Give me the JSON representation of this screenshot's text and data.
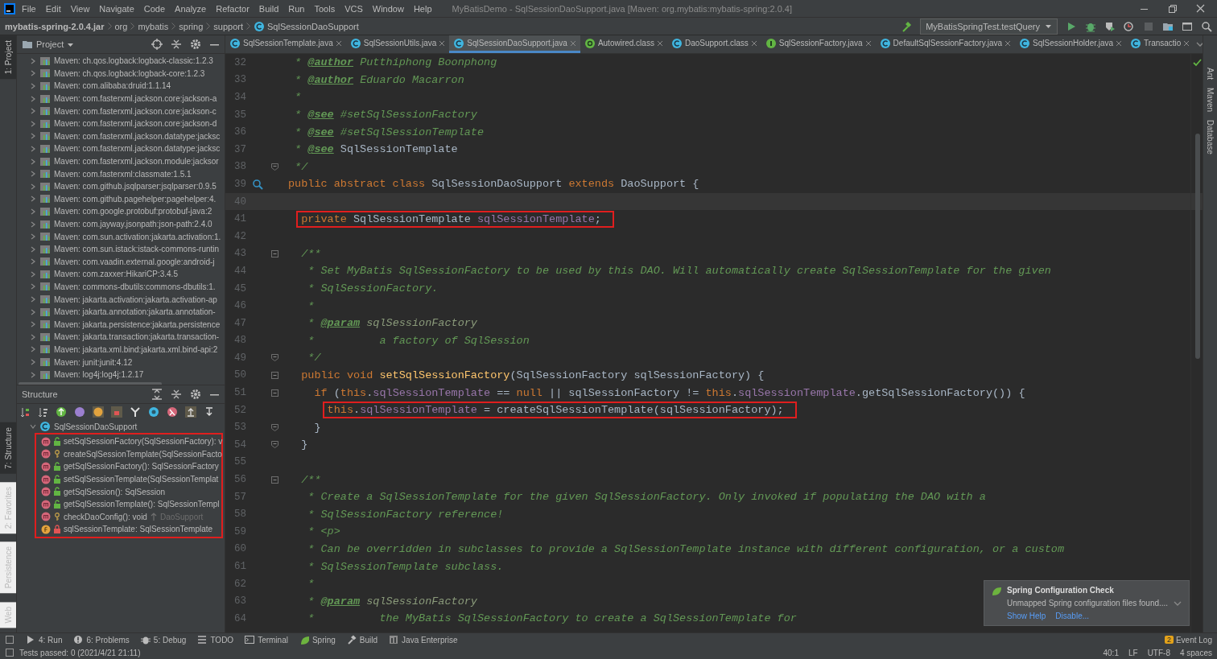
{
  "window": {
    "title": "MyBatisDemo - SqlSessionDaoSupport.java [Maven: org.mybatis:mybatis-spring:2.0.4]",
    "menu": [
      "File",
      "Edit",
      "View",
      "Navigate",
      "Code",
      "Analyze",
      "Refactor",
      "Build",
      "Run",
      "Tools",
      "VCS",
      "Window",
      "Help"
    ]
  },
  "breadcrumbs": [
    {
      "label": "mybatis-spring-2.0.4.jar",
      "kind": "jar"
    },
    {
      "label": "org",
      "kind": "package"
    },
    {
      "label": "mybatis",
      "kind": "package"
    },
    {
      "label": "spring",
      "kind": "package"
    },
    {
      "label": "support",
      "kind": "package"
    },
    {
      "label": "SqlSessionDaoSupport",
      "kind": "class"
    }
  ],
  "run_config": {
    "label": "MyBatisSpringTest.testQuery"
  },
  "left_strip": [
    {
      "label": "1: Project",
      "selected": true
    },
    {
      "label": "7: Structure",
      "selected": true
    },
    {
      "label": "2: Favorites",
      "selected": false
    },
    {
      "label": "Persistence",
      "selected": false
    },
    {
      "label": "Web",
      "selected": false
    }
  ],
  "right_strip": [
    {
      "label": "Ant"
    },
    {
      "label": "Maven"
    },
    {
      "label": "Database"
    }
  ],
  "project": {
    "title": "Project",
    "items": [
      {
        "label": "Maven: ch.qos.logback:logback-classic:1.2.3",
        "expanded": false
      },
      {
        "label": "Maven: ch.qos.logback:logback-core:1.2.3",
        "expanded": false
      },
      {
        "label": "Maven: com.alibaba:druid:1.1.14",
        "expanded": false
      },
      {
        "label": "Maven: com.fasterxml.jackson.core:jackson-a",
        "expanded": false
      },
      {
        "label": "Maven: com.fasterxml.jackson.core:jackson-c",
        "expanded": false
      },
      {
        "label": "Maven: com.fasterxml.jackson.core:jackson-d",
        "expanded": false
      },
      {
        "label": "Maven: com.fasterxml.jackson.datatype:jacksc",
        "expanded": false
      },
      {
        "label": "Maven: com.fasterxml.jackson.datatype:jacksc",
        "expanded": false
      },
      {
        "label": "Maven: com.fasterxml.jackson.module:jacksor",
        "expanded": false
      },
      {
        "label": "Maven: com.fasterxml:classmate:1.5.1",
        "expanded": false
      },
      {
        "label": "Maven: com.github.jsqlparser:jsqlparser:0.9.5",
        "expanded": false
      },
      {
        "label": "Maven: com.github.pagehelper:pagehelper:4.",
        "expanded": false
      },
      {
        "label": "Maven: com.google.protobuf:protobuf-java:2",
        "expanded": false
      },
      {
        "label": "Maven: com.jayway.jsonpath:json-path:2.4.0",
        "expanded": false
      },
      {
        "label": "Maven: com.sun.activation:jakarta.activation:1.",
        "expanded": false
      },
      {
        "label": "Maven: com.sun.istack:istack-commons-runtin",
        "expanded": false
      },
      {
        "label": "Maven: com.vaadin.external.google:android-j",
        "expanded": false
      },
      {
        "label": "Maven: com.zaxxer:HikariCP:3.4.5",
        "expanded": false
      },
      {
        "label": "Maven: commons-dbutils:commons-dbutils:1.",
        "expanded": false
      },
      {
        "label": "Maven: jakarta.activation:jakarta.activation-ap",
        "expanded": false
      },
      {
        "label": "Maven: jakarta.annotation:jakarta.annotation-",
        "expanded": false
      },
      {
        "label": "Maven: jakarta.persistence:jakarta.persistence",
        "expanded": false
      },
      {
        "label": "Maven: jakarta.transaction:jakarta.transaction-",
        "expanded": false
      },
      {
        "label": "Maven: jakarta.xml.bind:jakarta.xml.bind-api:2",
        "expanded": false
      },
      {
        "label": "Maven: junit:junit:4.12",
        "expanded": false
      },
      {
        "label": "Maven: log4j:log4j:1.2.17",
        "expanded": false
      }
    ]
  },
  "structure": {
    "title": "Structure",
    "root": {
      "label": "SqlSessionDaoSupport",
      "expanded": true,
      "highlighted": true,
      "children": [
        {
          "label": "setSqlSessionFactory(SqlSessionFactory): v",
          "kind": "public-method"
        },
        {
          "label": "createSqlSessionTemplate(SqlSessionFacto",
          "kind": "protected-method"
        },
        {
          "label": "getSqlSessionFactory(): SqlSessionFactory",
          "kind": "public-method"
        },
        {
          "label": "setSqlSessionTemplate(SqlSessionTemplat",
          "kind": "public-method"
        },
        {
          "label": "getSqlSession(): SqlSession",
          "kind": "public-method"
        },
        {
          "label": "getSqlSessionTemplate(): SqlSessionTempl",
          "kind": "public-method"
        },
        {
          "label": "checkDaoConfig(): void",
          "kind": "protected-method",
          "origin": "DaoSupport"
        },
        {
          "label": "sqlSessionTemplate: SqlSessionTemplate",
          "kind": "private-field"
        }
      ]
    }
  },
  "tabs": [
    {
      "label": "SqlSessionTemplate.java",
      "kind": "class",
      "selected": false
    },
    {
      "label": "SqlSessionUtils.java",
      "kind": "class",
      "selected": false
    },
    {
      "label": "SqlSessionDaoSupport.java",
      "kind": "class",
      "selected": true
    },
    {
      "label": "Autowired.class",
      "kind": "annotation",
      "selected": false
    },
    {
      "label": "DaoSupport.class",
      "kind": "class",
      "selected": false
    },
    {
      "label": "SqlSessionFactory.java",
      "kind": "interface",
      "selected": false
    },
    {
      "label": "DefaultSqlSessionFactory.java",
      "kind": "class",
      "selected": false
    },
    {
      "label": "SqlSessionHolder.java",
      "kind": "class",
      "selected": false
    },
    {
      "label": "Transactio",
      "kind": "class",
      "selected": false
    }
  ],
  "editor": {
    "lines": [
      {
        "number": "32",
        "current": false,
        "tokens": [
          {
            "kind": "doc",
            "text": " * "
          },
          {
            "kind": "doctag",
            "text": "@author"
          },
          {
            "kind": "doc",
            "text": " Putthiphong Boonphong"
          }
        ]
      },
      {
        "number": "33",
        "current": false,
        "tokens": [
          {
            "kind": "doc",
            "text": " * "
          },
          {
            "kind": "doctag",
            "text": "@author"
          },
          {
            "kind": "doc",
            "text": " Eduardo Macarron"
          }
        ]
      },
      {
        "number": "34",
        "current": false,
        "tokens": [
          {
            "kind": "doc",
            "text": " *"
          }
        ]
      },
      {
        "number": "35",
        "current": false,
        "tokens": [
          {
            "kind": "doc",
            "text": " * "
          },
          {
            "kind": "doctag",
            "text": "@see"
          },
          {
            "kind": "doc",
            "text": " #setSqlSessionFactory"
          }
        ]
      },
      {
        "number": "36",
        "current": false,
        "tokens": [
          {
            "kind": "doc",
            "text": " * "
          },
          {
            "kind": "doctag",
            "text": "@see"
          },
          {
            "kind": "doc",
            "text": " #setSqlSessionTemplate"
          }
        ]
      },
      {
        "number": "37",
        "current": false,
        "tokens": [
          {
            "kind": "doc",
            "text": " * "
          },
          {
            "kind": "doctag",
            "text": "@see"
          },
          {
            "kind": "plain",
            "text": " SqlSessionTemplate"
          }
        ]
      },
      {
        "number": "38",
        "current": false,
        "fold_end": true,
        "tokens": [
          {
            "kind": "doc",
            "text": " */"
          }
        ]
      },
      {
        "number": "39",
        "current": false,
        "implementation_marker": true,
        "tokens": [
          {
            "kind": "kw",
            "text": "public abstract class"
          },
          {
            "kind": "plain",
            "text": " SqlSessionDaoSupport "
          },
          {
            "kind": "kw",
            "text": "extends"
          },
          {
            "kind": "plain",
            "text": " DaoSupport {"
          }
        ]
      },
      {
        "number": "40",
        "current": true
      },
      {
        "number": "41",
        "current": false,
        "tokens": [
          {
            "kind": "kw",
            "text": "  private",
            "boxed": true
          },
          {
            "kind": "plain",
            "text": " SqlSessionTemplate ",
            "boxed": true
          },
          {
            "kind": "field",
            "text": "sqlSessionTemplate",
            "boxed": true
          },
          {
            "kind": "plain",
            "text": ";",
            "boxed": true
          }
        ]
      },
      {
        "number": "42",
        "current": false
      },
      {
        "number": "43",
        "current": false,
        "fold_start": true,
        "tokens": [
          {
            "kind": "doc",
            "text": "  /**"
          }
        ]
      },
      {
        "number": "44",
        "current": false,
        "tokens": [
          {
            "kind": "doc",
            "text": "   * Set MyBatis SqlSessionFactory to be used by this DAO. Will automatically create SqlSessionTemplate for the given"
          }
        ]
      },
      {
        "number": "45",
        "current": false,
        "tokens": [
          {
            "kind": "doc",
            "text": "   * SqlSessionFactory."
          }
        ]
      },
      {
        "number": "46",
        "current": false,
        "tokens": [
          {
            "kind": "doc",
            "text": "   *"
          }
        ]
      },
      {
        "number": "47",
        "current": false,
        "tokens": [
          {
            "kind": "doc",
            "text": "   * "
          },
          {
            "kind": "doctag",
            "text": "@param"
          },
          {
            "kind": "docparam",
            "text": " sqlSessionFactory"
          }
        ]
      },
      {
        "number": "48",
        "current": false,
        "tokens": [
          {
            "kind": "doc",
            "text": "   *          a factory of SqlSession"
          }
        ]
      },
      {
        "number": "49",
        "current": false,
        "fold_end": true,
        "tokens": [
          {
            "kind": "doc",
            "text": "   */"
          }
        ]
      },
      {
        "number": "50",
        "current": false,
        "fold_start": true,
        "tokens": [
          {
            "kind": "kw",
            "text": "  public void "
          },
          {
            "kind": "method",
            "text": "setSqlSessionFactory"
          },
          {
            "kind": "plain",
            "text": "(SqlSessionFactory sqlSessionFactory) {"
          }
        ]
      },
      {
        "number": "51",
        "current": false,
        "fold_start": true,
        "tokens": [
          {
            "kind": "kw",
            "text": "    if"
          },
          {
            "kind": "plain",
            "text": " ("
          },
          {
            "kind": "kw",
            "text": "this"
          },
          {
            "kind": "plain",
            "text": "."
          },
          {
            "kind": "field",
            "text": "sqlSessionTemplate"
          },
          {
            "kind": "plain",
            "text": " == "
          },
          {
            "kind": "kw",
            "text": "null"
          },
          {
            "kind": "plain",
            "text": " || sqlSessionFactory != "
          },
          {
            "kind": "kw",
            "text": "this"
          },
          {
            "kind": "plain",
            "text": "."
          },
          {
            "kind": "field",
            "text": "sqlSessionTemplate"
          },
          {
            "kind": "plain",
            "text": ".getSqlSessionFactory()) {"
          }
        ]
      },
      {
        "number": "52",
        "current": false,
        "tokens": [
          {
            "kind": "kw",
            "text": "      this",
            "boxed": true
          },
          {
            "kind": "plain",
            "text": ".",
            "boxed": true
          },
          {
            "kind": "field",
            "text": "sqlSessionTemplate",
            "boxed": true
          },
          {
            "kind": "plain",
            "text": " = createSqlSessionTemplate(sqlSessionFactory);",
            "boxed": true
          }
        ]
      },
      {
        "number": "53",
        "current": false,
        "fold_end": true,
        "tokens": [
          {
            "kind": "plain",
            "text": "    }"
          }
        ]
      },
      {
        "number": "54",
        "current": false,
        "fold_end": true,
        "tokens": [
          {
            "kind": "plain",
            "text": "  }"
          }
        ]
      },
      {
        "number": "55",
        "current": false
      },
      {
        "number": "56",
        "current": false,
        "fold_start": true,
        "tokens": [
          {
            "kind": "doc",
            "text": "  /**"
          }
        ]
      },
      {
        "number": "57",
        "current": false,
        "tokens": [
          {
            "kind": "doc",
            "text": "   * Create a SqlSessionTemplate for the given SqlSessionFactory. Only invoked if populating the DAO with a"
          }
        ]
      },
      {
        "number": "58",
        "current": false,
        "tokens": [
          {
            "kind": "doc",
            "text": "   * SqlSessionFactory reference!"
          }
        ]
      },
      {
        "number": "59",
        "current": false,
        "tokens": [
          {
            "kind": "doc",
            "text": "   * <p>"
          }
        ]
      },
      {
        "number": "60",
        "current": false,
        "tokens": [
          {
            "kind": "doc",
            "text": "   * Can be overridden in subclasses to provide a SqlSessionTemplate instance with different configuration, or a custom"
          }
        ]
      },
      {
        "number": "61",
        "current": false,
        "tokens": [
          {
            "kind": "doc",
            "text": "   * SqlSessionTemplate subclass."
          }
        ]
      },
      {
        "number": "62",
        "current": false,
        "tokens": [
          {
            "kind": "doc",
            "text": "   *"
          }
        ]
      },
      {
        "number": "63",
        "current": false,
        "tokens": [
          {
            "kind": "doc",
            "text": "   * "
          },
          {
            "kind": "doctag",
            "text": "@param"
          },
          {
            "kind": "docparam",
            "text": " sqlSessionFactory"
          }
        ]
      },
      {
        "number": "64",
        "current": false,
        "tokens": [
          {
            "kind": "doc",
            "text": "   *          the MyBatis SqlSessionFactory to create a SqlSessionTemplate for"
          }
        ]
      }
    ]
  },
  "notification": {
    "title": "Spring Configuration Check",
    "message": "Unmapped Spring configuration files found....",
    "links": [
      "Show Help",
      "Disable..."
    ]
  },
  "tool_windows": [
    {
      "label": "4: Run",
      "kind": "run"
    },
    {
      "label": "6: Problems",
      "kind": "problems"
    },
    {
      "label": "5: Debug",
      "kind": "debug"
    },
    {
      "label": "TODO",
      "kind": "todo"
    },
    {
      "label": "Terminal",
      "kind": "terminal"
    },
    {
      "label": "Spring",
      "kind": "spring"
    },
    {
      "label": "Build",
      "kind": "build"
    },
    {
      "label": "Java Enterprise",
      "kind": "enterprise"
    }
  ],
  "event_log": {
    "label": "Event Log",
    "count": "2"
  },
  "status_bar": {
    "message": "Tests passed: 0 (2021/4/21 21:11)",
    "items": [
      "40:1",
      "LF",
      "UTF-8",
      "4 spaces"
    ]
  }
}
